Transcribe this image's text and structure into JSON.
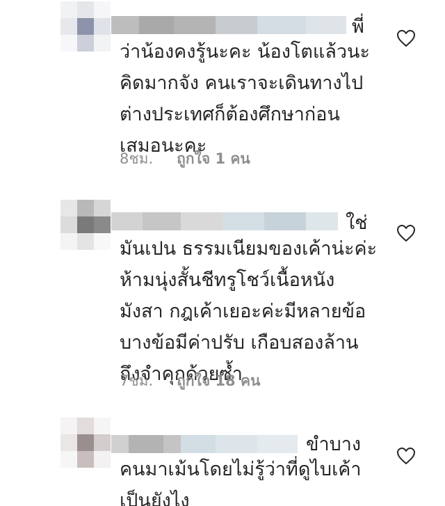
{
  "comments": [
    {
      "first_word": "พี่",
      "text_lines": [
        "ว่าน้องคงรู้นะคะ น้องโตแล้วนะ",
        "คิดมากจัง คนเราจะเดินทางไป",
        "ต่างประเทศก็ต้องศึกษาก่อน",
        "เสมอนะคะ"
      ],
      "time": "8ชม.",
      "likes": "ถูกใจ 1 คน",
      "like_icon": "heart-outline-icon"
    },
    {
      "first_word": "ใช่",
      "text_lines": [
        "มันเปน ธรรมเนียมของเค้าน่ะค่ะ",
        "ห้ามนุ่งสั้นชีทรูโชว์เนื้อหนัง",
        "มังสา กฎเค้าเยอะค่ะมีหลายข้อ",
        "บางข้อมีค่าปรับ  เกือบสองล้าน",
        "ถึงจำคุกด้วยซ้ำ"
      ],
      "time": "7ชม.",
      "likes": "ถูกใจ 18 คน",
      "like_icon": "heart-outline-icon"
    },
    {
      "first_word": "ขำบาง",
      "text_lines": [
        "คนมาเม้นโดยไม่รู้ว่าที่ดูไบเค้า",
        "เป็นยังไง"
      ],
      "like_icon": "heart-outline-icon"
    }
  ]
}
